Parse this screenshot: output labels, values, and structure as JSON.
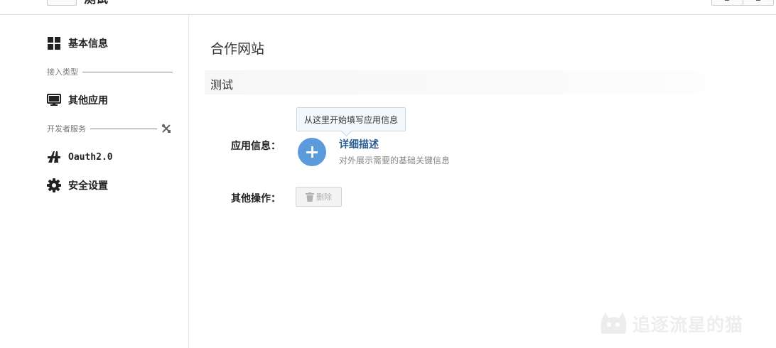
{
  "header": {
    "title": "测试"
  },
  "sidebar": {
    "items": [
      {
        "label": "基本信息",
        "icon": "grid-icon"
      },
      {
        "label": "其他应用",
        "icon": "monitor-icon"
      },
      {
        "label": "Oauth2.0",
        "icon": "oauth-icon"
      },
      {
        "label": "安全设置",
        "icon": "gear-icon"
      }
    ],
    "sections": [
      {
        "label": "接入类型"
      },
      {
        "label": "开发者服务",
        "icon": "tools-icon"
      }
    ]
  },
  "main": {
    "page_title": "合作网站",
    "section_title": "测试",
    "tooltip": "从这里开始填写应用信息",
    "app_info_label": "应用信息：",
    "detail": {
      "title": "详细描述",
      "description": "对外展示需要的基础关键信息",
      "icon": "plus-icon"
    },
    "other_ops_label": "其他操作：",
    "delete_button": {
      "label": "删除",
      "icon": "trash-icon"
    }
  },
  "watermark": {
    "text": "追逐流星的猫"
  },
  "colors": {
    "accent": "#5b9bdc",
    "link": "#2a5d93",
    "border": "#e3e3e3"
  }
}
